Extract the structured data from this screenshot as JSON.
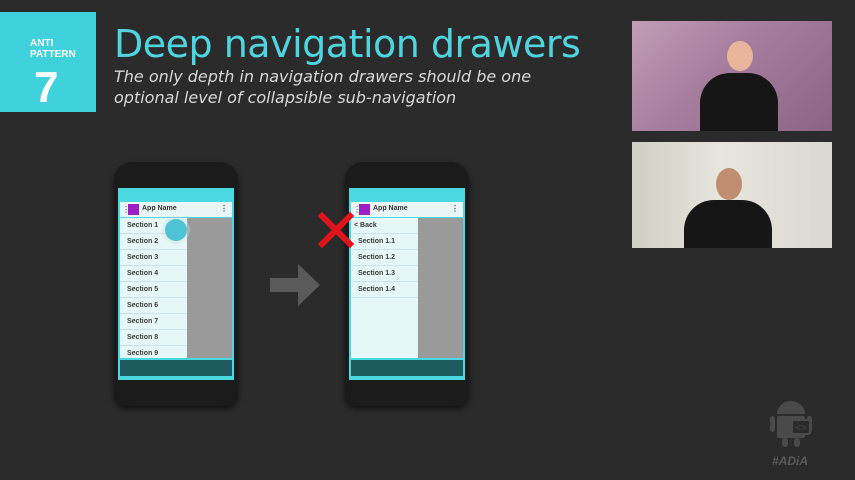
{
  "badge": {
    "line1": "ANTI",
    "line2": "PATTERN",
    "number": "7"
  },
  "title": "Deep navigation drawers",
  "subtitle": "The only depth in navigation drawers should be one optional level of collapsible sub-navigation",
  "left_phone": {
    "app_name": "App Name",
    "items": [
      "Section 1",
      "Section 2",
      "Section 3",
      "Section 4",
      "Section 5",
      "Section 6",
      "Section 7",
      "Section 8",
      "Section 9"
    ]
  },
  "right_phone": {
    "app_name": "App Name",
    "items": [
      "< Back",
      "Section 1.1",
      "Section 1.2",
      "Section 1.3",
      "Section 1.4"
    ]
  },
  "hashtag": "#ADiA",
  "colors": {
    "accent": "#4fd4e0",
    "badge": "#3fd1dc",
    "x_mark": "#e0141b",
    "app_icon": "#9b1fc4"
  }
}
